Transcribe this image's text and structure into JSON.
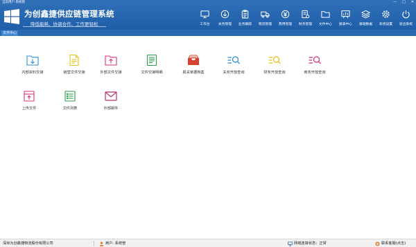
{
  "window": {
    "title": "当前用户:系统管",
    "controls": [
      "—",
      "□",
      "✕"
    ]
  },
  "header": {
    "app_title": "为创鑫捷供应链管理系统",
    "slogan": "降低能耗、协调合作、工作更轻松",
    "nav": [
      {
        "label": "工作台",
        "icon": "monitor-icon"
      },
      {
        "label": "关务管理",
        "icon": "download-circle-icon"
      },
      {
        "label": "业务跟踪",
        "icon": "clipboard-icon"
      },
      {
        "label": "物流管理",
        "icon": "truck-icon"
      },
      {
        "label": "费用管理",
        "icon": "yen-circle-icon"
      },
      {
        "label": "财务管理",
        "icon": "finance-doc-icon"
      },
      {
        "label": "文件中心",
        "icon": "folder-icon"
      },
      {
        "label": "报表中心",
        "icon": "chart-board-icon"
      },
      {
        "label": "基础数据",
        "icon": "layers-icon"
      },
      {
        "label": "系统设置",
        "icon": "gear-icon"
      },
      {
        "label": "退出系统",
        "icon": "power-icon"
      }
    ]
  },
  "tabs": [
    {
      "label": "文件中心"
    }
  ],
  "tiles": [
    {
      "label": "内部资料交接",
      "icon": "folder-download-icon",
      "color": "#2e8fd6"
    },
    {
      "label": "链营文件交接",
      "icon": "document-icon",
      "color": "#e6c21a"
    },
    {
      "label": "外部文件交接",
      "icon": "folder-upload-icon",
      "color": "#d9327a"
    },
    {
      "label": "文件交接明细",
      "icon": "list-document-icon",
      "color": "#2e9d47"
    },
    {
      "label": "报关单据档案",
      "icon": "inbox-tray-icon",
      "color": "#d8412f"
    },
    {
      "label": "关务开放查询",
      "icon": "search-list-icon",
      "color": "#2e8fd6"
    },
    {
      "label": "财务开放查询",
      "icon": "search-list-icon",
      "color": "#e6c21a"
    },
    {
      "label": "商务开放查询",
      "icon": "search-list-icon",
      "color": "#d9327a"
    },
    {
      "label": "上传文件",
      "icon": "upload-file-icon",
      "color": "#d9327a"
    },
    {
      "label": "文件列表",
      "icon": "file-list-icon",
      "color": "#2e9d47"
    },
    {
      "label": "外部邮件",
      "icon": "mail-icon",
      "color": "#b0306e"
    }
  ],
  "status": {
    "company": "深圳为创鑫捷物流股份有限公司",
    "user": "用户: 系统管",
    "network": "网络连接状态：正常",
    "support": "联系客服(点击)"
  }
}
